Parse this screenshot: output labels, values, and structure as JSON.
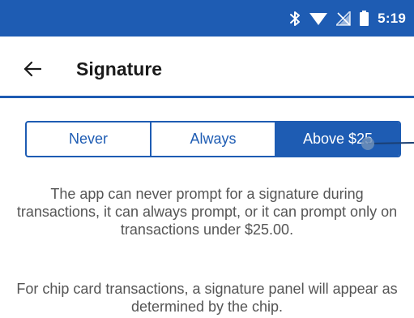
{
  "status_bar": {
    "time": "5:19",
    "icons": [
      "bluetooth-icon",
      "wifi-icon",
      "no-signal-icon",
      "battery-icon"
    ],
    "background_color": "#1e5cb3"
  },
  "app_bar": {
    "back_icon": "arrow-left-icon",
    "title": "Signature"
  },
  "segmented_control": {
    "options": [
      "Never",
      "Always",
      "Above $25"
    ],
    "selected_index": 2,
    "accent_color": "#1e5cb3"
  },
  "descriptions": [
    "The app can never prompt for a signature during transactions, it can always prompt, or it can prompt only on transactions under $25.00.",
    "For chip card transactions, a signature panel will appear as determined by the chip."
  ]
}
